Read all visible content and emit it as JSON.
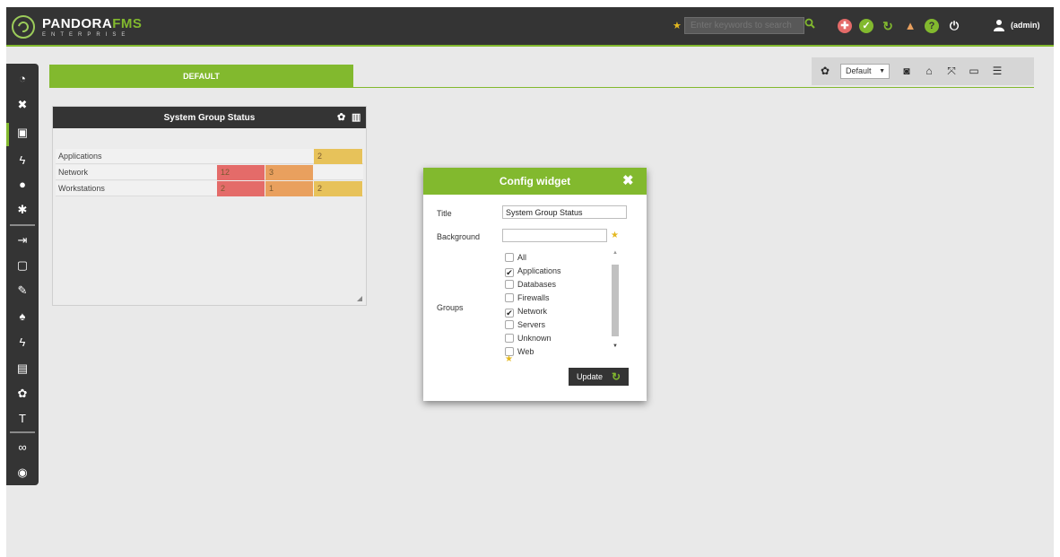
{
  "header": {
    "brand_main": "PANDORA",
    "brand_accent": "FMS",
    "brand_sub": "ENTERPRISE",
    "search_placeholder": "Enter keywords to search",
    "user": "(admin)",
    "icons": [
      "lifebuoy-icon",
      "check-icon",
      "refresh-icon",
      "warning-icon",
      "help-icon",
      "power-icon",
      "user-icon"
    ]
  },
  "sidebar": {
    "items": [
      "monitoring-icon",
      "topology-icon",
      "reporting-icon",
      "events-icon",
      "users-icon",
      "servers-icon",
      "login-icon",
      "profile-icon",
      "tools-icon",
      "alerts-icon",
      "ondemand-icon",
      "files-icon",
      "settings-icon",
      "metaconsole-icon",
      "links-icon",
      "update-icon"
    ]
  },
  "tab": {
    "label": "DEFAULT"
  },
  "toolbar": {
    "select_value": "Default"
  },
  "widget": {
    "title": "System Group Status",
    "rows": [
      {
        "label": "Applications",
        "cells": [
          {
            "value": "",
            "color": ""
          },
          {
            "value": "",
            "color": ""
          },
          {
            "value": "2",
            "color": "#e7c25a"
          }
        ]
      },
      {
        "label": "Network",
        "cells": [
          {
            "value": "12",
            "color": "#e46b69"
          },
          {
            "value": "3",
            "color": "#e9a05e"
          },
          {
            "value": "",
            "color": ""
          }
        ]
      },
      {
        "label": "Workstations",
        "cells": [
          {
            "value": "2",
            "color": "#e46b69"
          },
          {
            "value": "1",
            "color": "#e9a05e"
          },
          {
            "value": "2",
            "color": "#e7c25a"
          }
        ]
      }
    ]
  },
  "modal": {
    "title": "Config widget",
    "title_label": "Title",
    "title_value": "System Group Status",
    "background_label": "Background",
    "groups_label": "Groups",
    "groups": [
      {
        "name": "All",
        "checked": false
      },
      {
        "name": "Applications",
        "checked": true
      },
      {
        "name": "Databases",
        "checked": false
      },
      {
        "name": "Firewalls",
        "checked": false
      },
      {
        "name": "Network",
        "checked": true
      },
      {
        "name": "Servers",
        "checked": false
      },
      {
        "name": "Unknown",
        "checked": false
      },
      {
        "name": "Web",
        "checked": false
      }
    ],
    "update_label": "Update"
  },
  "colors": {
    "accent": "#82b92e",
    "dark": "#343434",
    "critical": "#e46b69",
    "warning": "#e9a05e",
    "unknown": "#e7c25a"
  }
}
